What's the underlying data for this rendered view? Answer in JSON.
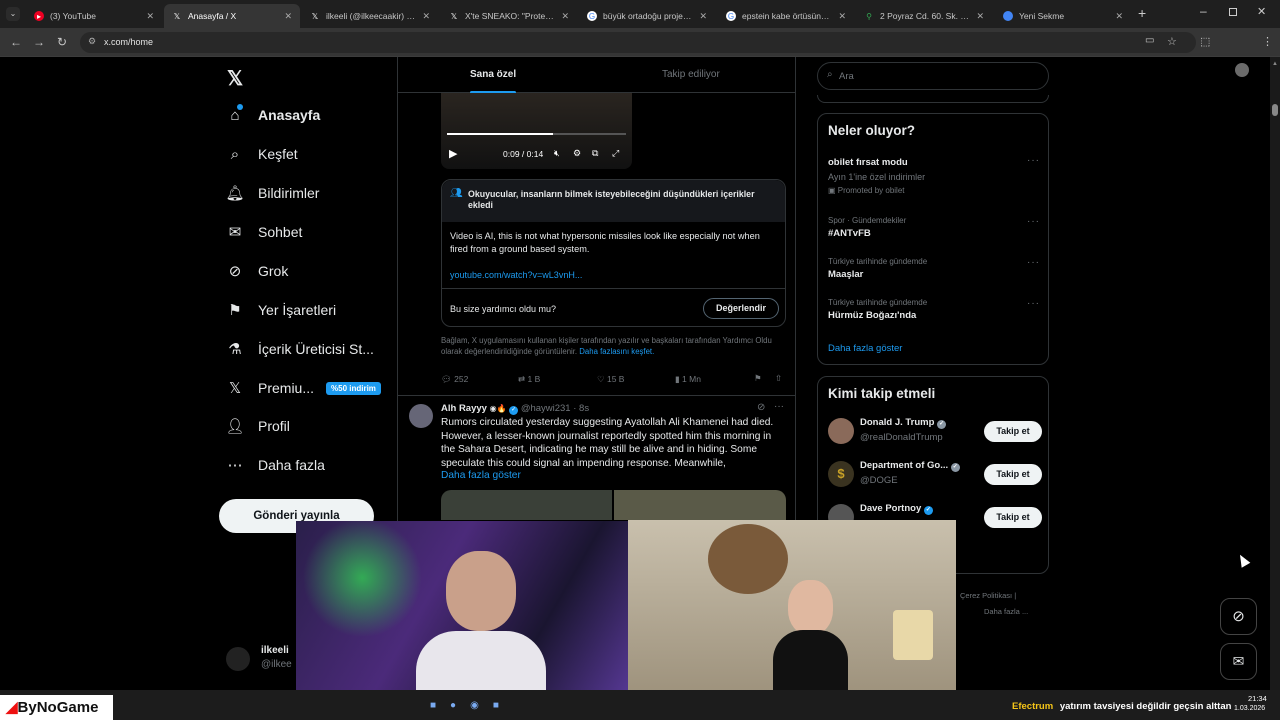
{
  "browser": {
    "tabs": [
      {
        "title": "(3) YouTube",
        "icon": "youtube-icon",
        "active": false
      },
      {
        "title": "Anasayfa / X",
        "icon": "x-icon",
        "active": true
      },
      {
        "title": "ilkeeli (@ilkeecaakir) / X",
        "icon": "x-icon",
        "active": false
      },
      {
        "title": "X'te SNEAKO: \"Protect Tu...",
        "icon": "x-icon",
        "active": false
      },
      {
        "title": "büyük ortadoğu projesi h...",
        "icon": "google-icon",
        "active": false
      },
      {
        "title": "epstein kabe örtüsünü kim...",
        "icon": "google-icon",
        "active": false
      },
      {
        "title": "2 Poyraz Cd. 60. Sk. - Goo...",
        "icon": "maps-icon",
        "active": false
      },
      {
        "title": "Yeni Sekme",
        "icon": "chrome-icon",
        "active": false
      }
    ],
    "url": "x.com/home"
  },
  "sidebar": {
    "items": [
      {
        "label": "Anasayfa",
        "icon": "home-icon"
      },
      {
        "label": "Keşfet",
        "icon": "search-icon"
      },
      {
        "label": "Bildirimler",
        "icon": "bell-icon"
      },
      {
        "label": "Sohbet",
        "icon": "mail-icon"
      },
      {
        "label": "Grok",
        "icon": "grok-icon"
      },
      {
        "label": "Yer İşaretleri",
        "icon": "bookmark-icon"
      },
      {
        "label": "İçerik Üreticisi St...",
        "icon": "creator-icon"
      },
      {
        "label": "Premiu...",
        "icon": "x-premium-icon",
        "badge": "%50 indirim"
      },
      {
        "label": "Profil",
        "icon": "person-icon"
      },
      {
        "label": "Daha fazla",
        "icon": "more-circle-icon"
      }
    ],
    "post_button": "Gönderi yayınla",
    "account": {
      "name": "ilkeeli",
      "handle": "@ilkee"
    }
  },
  "timeline": {
    "tabs": [
      "Sana özel",
      "Takip ediliyor"
    ],
    "video": {
      "time": "0:09 / 0:14",
      "progress": 0.59
    },
    "community_note": {
      "header": "Okuyucular, insanların bilmek isteyebileceğini düşündükleri içerikler ekledi",
      "body": "Video is AI, this is not what hypersonic missiles look like especially not when fired from a ground based system.",
      "link": "youtube.com/watch?v=wL3vnH...",
      "question": "Bu size yardımcı oldu mu?",
      "rate_button": "Değerlendir",
      "footer": "Bağlam, X uygulamasını kullanan kişiler tarafından yazılır ve başkaları tarafından Yardımcı Oldu olarak değerlendirildiğinde görüntülenir.",
      "footer_link": "Daha fazlasını keşfet."
    },
    "actions": {
      "replies": "252",
      "reposts": "1 B",
      "likes": "15 B",
      "views": "1 Mn"
    },
    "post2": {
      "name": "Alh Rayyy",
      "handle": "@haywi231",
      "time": "· 8s",
      "text": "Rumors circulated yesterday suggesting Ayatollah Ali Khamenei had died. However, a lesser-known journalist reportedly spotted him this morning in the Sahara Desert, indicating he may still be alive and in hiding. Some speculate this could signal an impending response. Meanwhile,",
      "show_more": "Daha fazla göster"
    }
  },
  "right": {
    "search_placeholder": "Ara",
    "trends_title": "Neler oluyor?",
    "trends": [
      {
        "meta": "",
        "name": "obilet fırsat modu",
        "sub": "Ayın 1'ine özel indirimler",
        "promo": "Promoted by obilet"
      },
      {
        "meta": "Spor · Gündemdekiler",
        "name": "#ANTvFB"
      },
      {
        "meta": "Türkiye tarihinde gündemde",
        "name": "Maaşlar"
      },
      {
        "meta": "Türkiye tarihinde gündemde",
        "name": "Hürmüz Boğazı'nda"
      }
    ],
    "show_more": "Daha fazla göster",
    "follow_title": "Kimi takip etmeli",
    "follow": [
      {
        "name": "Donald J. Trump",
        "handle": "@realDonaldTrump",
        "button": "Takip et"
      },
      {
        "name": "Department of Go...",
        "handle": "@DOGE",
        "button": "Takip et"
      },
      {
        "name": "Dave Portnoy",
        "handle": "",
        "button": "Takip et"
      }
    ],
    "footer_links": [
      "Çerez Politikası",
      "|",
      "Daha fazla ..."
    ]
  },
  "overlay": {
    "brand": "ByNoGame"
  },
  "taskbar": {
    "ticker_name": "Efectrum",
    "ticker_text": "yatırım tavsiyesi değildir geçsin alttan",
    "time": "21:34",
    "date": "1.03.2026"
  },
  "colors": {
    "accent": "#1d9bf0",
    "background": "#000000",
    "border": "#2f3336",
    "muted": "#71767b"
  }
}
